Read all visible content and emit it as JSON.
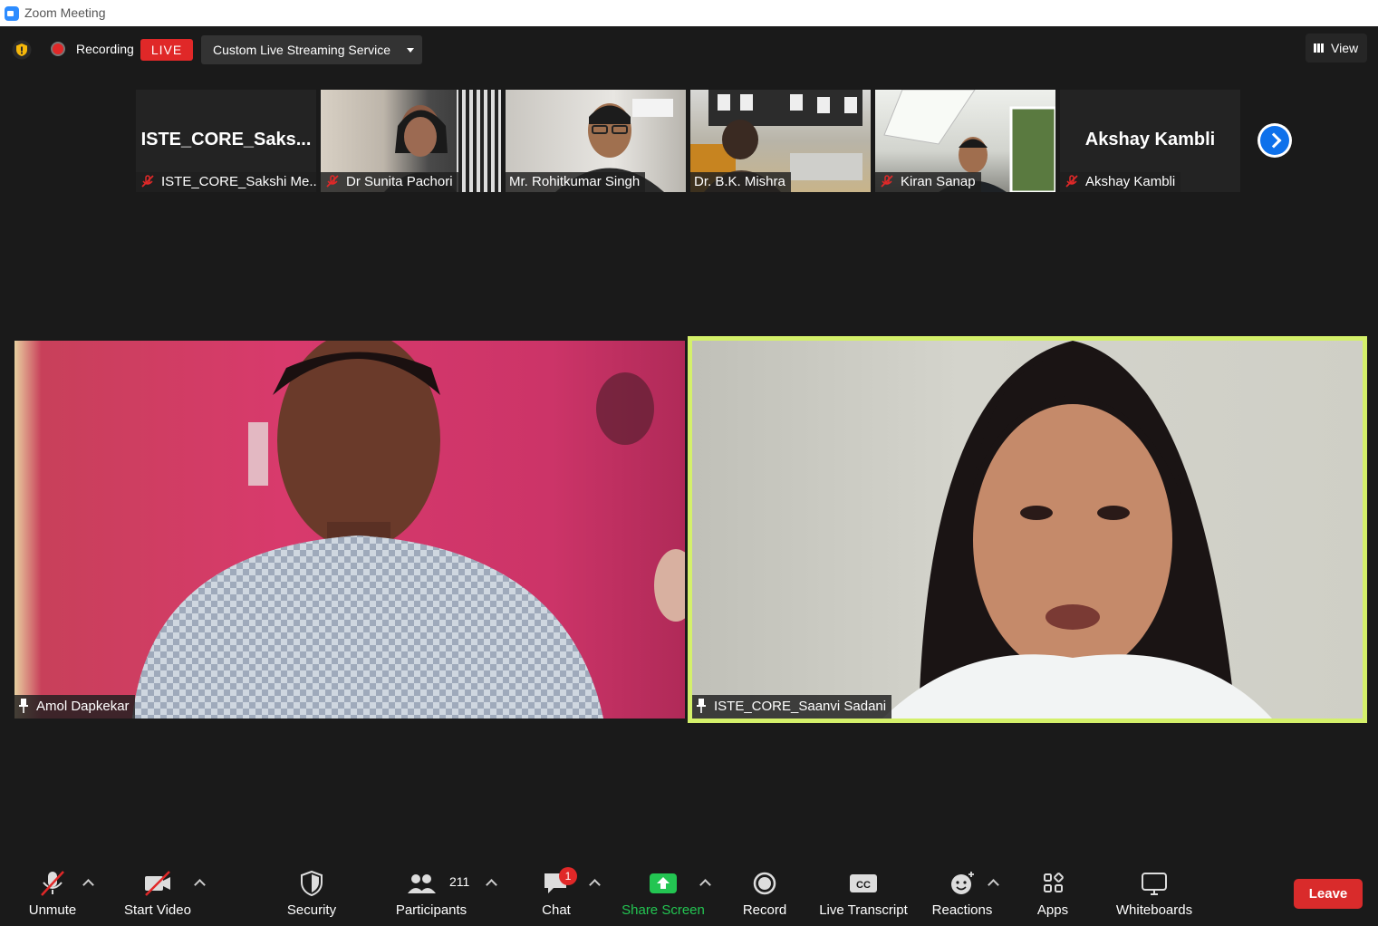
{
  "window": {
    "title": "Zoom Meeting"
  },
  "topbar": {
    "recording_label": "Recording",
    "live_badge": "LIVE",
    "stream_service": "Custom Live Streaming Service",
    "view_label": "View"
  },
  "gallery_strip": [
    {
      "name": "ISTE_CORE_Sakshi Me...",
      "display_text": "ISTE_CORE_Saks...",
      "muted": true,
      "video": false
    },
    {
      "name": "Dr Sunita Pachori",
      "muted": true,
      "video": true
    },
    {
      "name": "Mr. Rohitkumar Singh",
      "muted": false,
      "video": true
    },
    {
      "name": "Dr. B.K. Mishra",
      "muted": false,
      "video": true
    },
    {
      "name": "Kiran Sanap",
      "muted": true,
      "video": true
    },
    {
      "name": "Akshay Kambli",
      "display_text": "Akshay Kambli",
      "muted": true,
      "video": false
    }
  ],
  "main_videos": [
    {
      "name": "Amol Dapkekar",
      "pinned": true,
      "active_speaker": false
    },
    {
      "name": "ISTE_CORE_Saanvi Sadani",
      "pinned": true,
      "active_speaker": true
    }
  ],
  "toolbar": {
    "unmute": "Unmute",
    "start_video": "Start Video",
    "security": "Security",
    "participants": "Participants",
    "participants_count": "211",
    "chat": "Chat",
    "chat_unread": "1",
    "share_screen": "Share Screen",
    "record": "Record",
    "live_transcript": "Live Transcript",
    "reactions": "Reactions",
    "apps": "Apps",
    "whiteboards": "Whiteboards",
    "leave": "Leave"
  },
  "colors": {
    "background": "#1a1a1a",
    "live_red": "#e02828",
    "share_green": "#23c552",
    "active_speaker_border": "#d4f06a",
    "leave_red": "#d92b2b",
    "next_blue": "#0e71eb"
  }
}
